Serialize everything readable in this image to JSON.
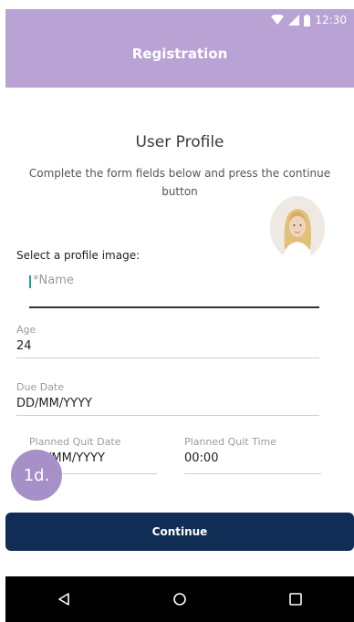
{
  "status_bar": {
    "time": "12:30"
  },
  "app_bar": {
    "title": "Registration"
  },
  "form": {
    "title": "User Profile",
    "subtitle": "Complete the form fields below and press the continue button",
    "profile_image_label": "Select a profile image:",
    "name": {
      "required_mark": "*",
      "placeholder": "Name",
      "value": ""
    },
    "age": {
      "label": "Age",
      "value": "24"
    },
    "due_date": {
      "label": "Due Date",
      "value": "DD/MM/YYYY"
    },
    "planned_quit_date": {
      "label": "Planned Quit Date",
      "value": "DD/MM/YYYY"
    },
    "planned_quit_time": {
      "label": "Planned Quit Time",
      "value": "00:00"
    }
  },
  "step_badge": {
    "label": "1d."
  },
  "continue_button": {
    "label": "Continue"
  },
  "colors": {
    "app_bar": "#b9a2d4",
    "button": "#0f2d55",
    "badge": "#a690c7",
    "cursor": "#1aa39a"
  },
  "icons": [
    "wifi-icon",
    "signal-icon",
    "battery-icon",
    "back-icon",
    "home-icon",
    "recents-icon"
  ]
}
